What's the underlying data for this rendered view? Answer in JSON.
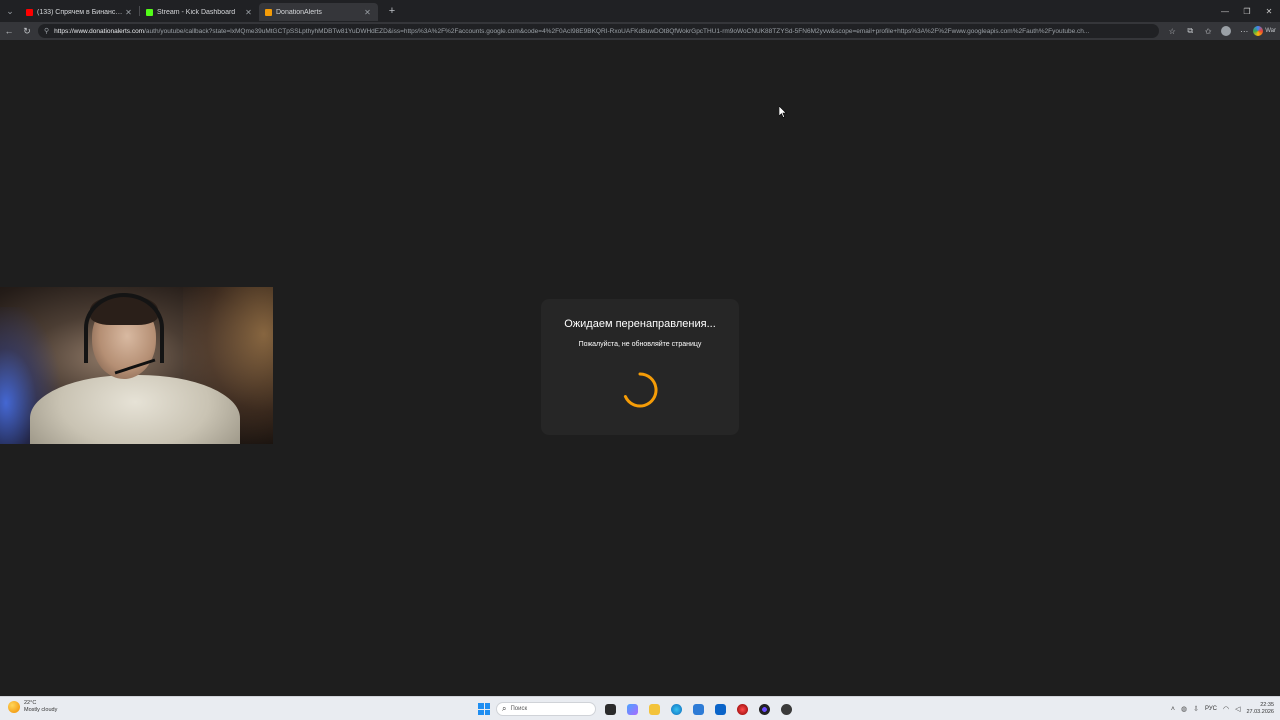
{
  "browser": {
    "tabs": [
      {
        "title": "(133) Спрячем в Бинанс (prod. by",
        "favicon_color": "#ff0000",
        "active": false
      },
      {
        "title": "Stream - Kick Dashboard",
        "favicon_color": "#53fc18",
        "active": false
      },
      {
        "title": "DonationAlerts",
        "favicon_color": "#f59c07",
        "active": true
      }
    ],
    "new_tab_glyph": "+",
    "close_glyph": "✕",
    "url_host": "https://www.donationalerts.com",
    "url_rest": "/auth/youtube/callback?state=lxMQme39uMtGCTpSSLpthyhMDBTw81YuDWHdEZD&iss=https%3A%2F%2Faccounts.google.com&code=4%2F0AcI98E9BKQRI-RxoUAFKd8uwDOt8QfWokrGpcTHU1-rm9oWoCNUK88TZYSd-5FN6M2yvw&scope=email+profile+https%3A%2F%2Fwww.googleapis.com%2Fauth%2Fyoutube.ch...",
    "extension_label": "War"
  },
  "page": {
    "heading": "Ожидаем перенаправления...",
    "subheading": "Пожалуйста, не обновляйте страницу",
    "spinner_color": "#f59c07",
    "card_color": "#262626",
    "background_color": "#1e1e1e"
  },
  "taskbar": {
    "weather_temp": "22°C",
    "weather_desc": "Mostly cloudy",
    "search_placeholder": "Поиск",
    "language": "РУС",
    "time": "22:35",
    "date": "27.03.2026"
  }
}
